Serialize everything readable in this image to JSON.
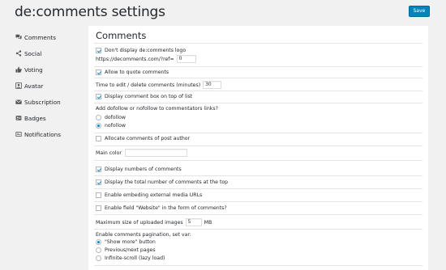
{
  "header": {
    "title": "de:comments settings",
    "save_label": "Save"
  },
  "nav": {
    "items": [
      {
        "label": "Comments",
        "icon": "comments-icon"
      },
      {
        "label": "Social",
        "icon": "share-icon"
      },
      {
        "label": "Voting",
        "icon": "thumbs-up-icon"
      },
      {
        "label": "Avatar",
        "icon": "avatar-icon"
      },
      {
        "label": "Subscription",
        "icon": "email-icon"
      },
      {
        "label": "Badges",
        "icon": "badge-icon"
      },
      {
        "label": "Notifications",
        "icon": "notifications-icon"
      }
    ]
  },
  "panel": {
    "title": "Comments",
    "logo_checkbox": {
      "label": "Don't display de:comments logo",
      "checked": true
    },
    "ref_label": "https://decomments.com/?ref=",
    "ref_value": "0",
    "quote_checkbox": {
      "label": "Allow to quote comments",
      "checked": true
    },
    "edit_time_label": "Time to edit / delete comments (minutes)",
    "edit_time_value": "30",
    "comment_box_checkbox": {
      "label": "Display comment box on top of list",
      "checked": true
    },
    "follow_question": "Add dofollow or nofollow to commentators links?",
    "follow_options": [
      {
        "label": "dofollow",
        "checked": false
      },
      {
        "label": "nofollow",
        "checked": true
      }
    ],
    "allocate_checkbox": {
      "label": "Allocate comments of post author",
      "checked": false
    },
    "main_color_label": "Main color",
    "main_color_value": "",
    "display_numbers_checkbox": {
      "label": "Display numbers of comments",
      "checked": true
    },
    "total_top_checkbox": {
      "label": "Display the total number of comments at the top",
      "checked": true
    },
    "embed_checkbox": {
      "label": "Enable embeding external media URLs",
      "checked": false
    },
    "website_checkbox": {
      "label": "Enable field \"Website\" in the form of comments?",
      "checked": false
    },
    "max_size_label": "Maximum size of uploaded images",
    "max_size_value": "5",
    "max_size_unit": "MB",
    "pagination_question": "Enable comments pagination, set var:",
    "pagination_options": [
      {
        "label": "\"Show more\" button",
        "checked": true
      },
      {
        "label": "Previous/next pages",
        "checked": false
      },
      {
        "label": "Infinite-scroll (lazy load)",
        "checked": false
      }
    ]
  },
  "colors": {
    "accent": "#0085ba",
    "check": "#1e8cbe",
    "background": "#f1f1f1"
  }
}
